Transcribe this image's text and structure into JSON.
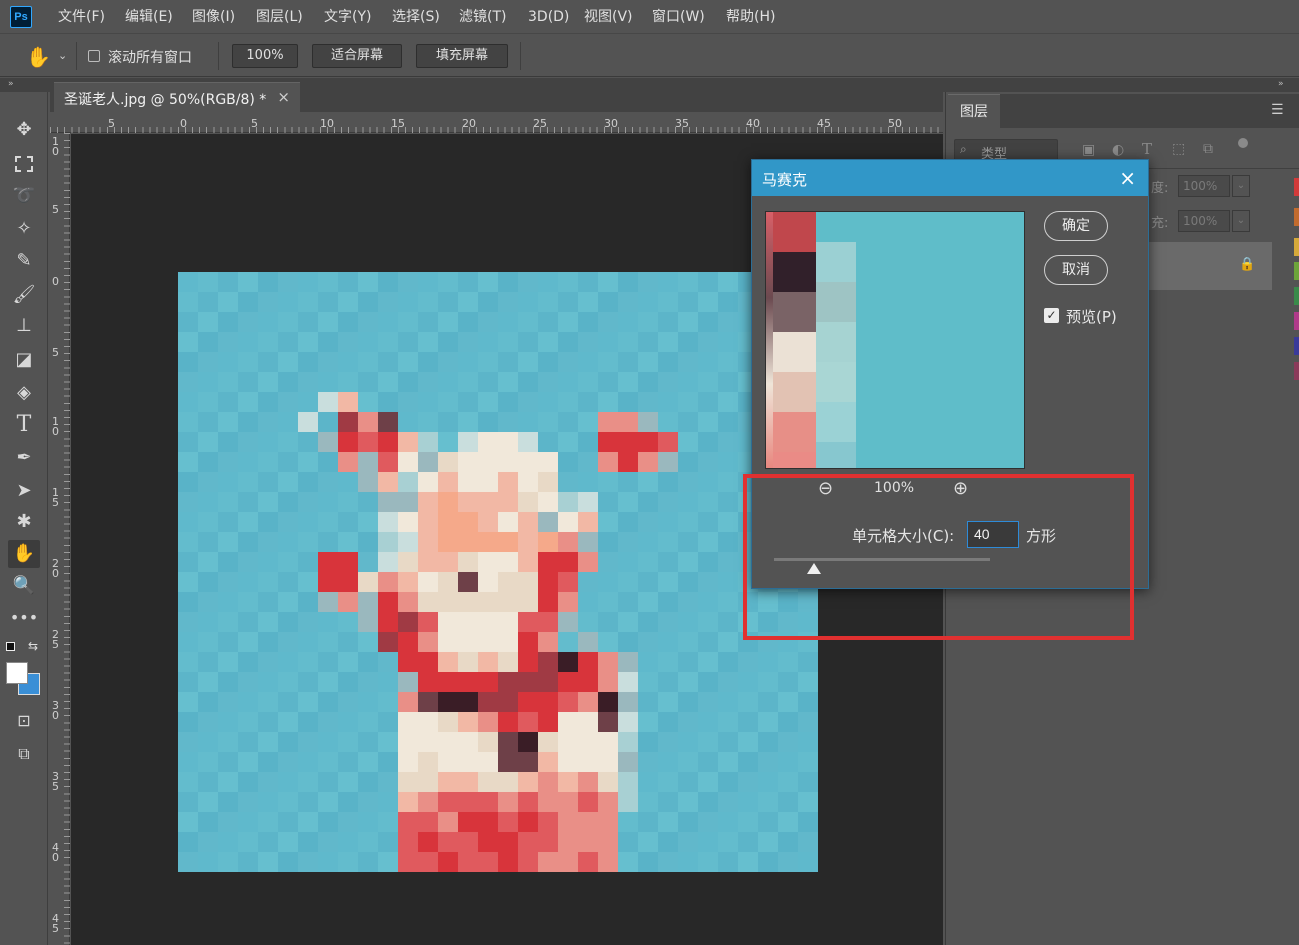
{
  "app": {
    "logo": "Ps"
  },
  "menu": [
    "文件(F)",
    "编辑(E)",
    "图像(I)",
    "图层(L)",
    "文字(Y)",
    "选择(S)",
    "滤镜(T)",
    "3D(D)",
    "视图(V)",
    "窗口(W)",
    "帮助(H)"
  ],
  "options": {
    "scroll_all": "滚动所有窗口",
    "zoom": "100%",
    "fit_screen": "适合屏幕",
    "fill_screen": "填充屏幕"
  },
  "document": {
    "tab_title": "圣诞老人.jpg @ 50%(RGB/8) *",
    "close": "×"
  },
  "ruler": {
    "h_labels": [
      "5",
      "0",
      "5",
      "10",
      "15",
      "20",
      "25",
      "30",
      "35",
      "40",
      "45",
      "50"
    ],
    "v_labels": [
      "1 0",
      "5",
      "0",
      "5",
      "1 0",
      "1 5",
      "2 0",
      "2 5",
      "3 0",
      "3 5",
      "4 0",
      "4 5"
    ]
  },
  "layers_panel": {
    "tab": "图层",
    "filter_kind": "类型",
    "opacity_label": "度:",
    "opacity_value": "100%",
    "fill_label": "充:",
    "fill_value": "100%"
  },
  "dialog": {
    "title": "马赛克",
    "ok": "确定",
    "cancel": "取消",
    "preview_label": "预览(P)",
    "preview_checked": true,
    "zoom_level": "100%",
    "cell_size_label": "单元格大小(C):",
    "cell_size_value": "40",
    "cell_size_unit": "方形",
    "slider_value": 40
  },
  "colors": {
    "accent": "#3197c8",
    "highlight": "#e03030",
    "sky": "#5fb9cc"
  }
}
